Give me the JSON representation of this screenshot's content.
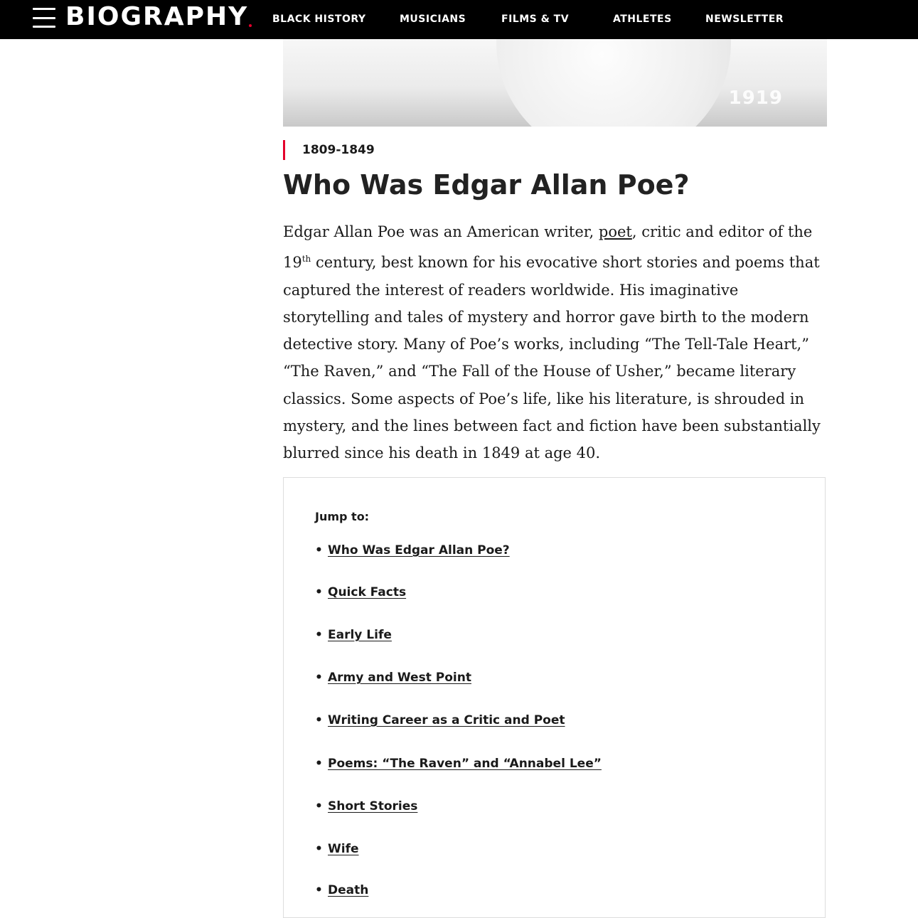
{
  "nav": {
    "logo_text": "BIOGRAPHY",
    "items": [
      {
        "label": "BLACK HISTORY"
      },
      {
        "label": "MUSICIANS"
      },
      {
        "label": "FILMS & TV"
      },
      {
        "label": "ATHLETES"
      },
      {
        "label": "NEWSLETTER"
      }
    ]
  },
  "hero": {
    "credit": "1919"
  },
  "article": {
    "dates": "1809-1849",
    "headline": "Who Was Edgar Allan Poe?",
    "lede_parts": {
      "p1": "Edgar Allan Poe was an American writer, ",
      "link_poet": "poet",
      "p2": ", critic and editor of the 19",
      "sup": "th",
      "p3": " century, best known for his evocative short stories and poems that captured the interest of readers worldwide. His imaginative storytelling and tales of mystery and horror gave birth to the modern detective story. Many of Poe’s works, including “The Tell-Tale Heart,” “The Raven,” and “The Fall of the House of Usher,” became literary classics. Some aspects of Poe’s life, like his literature, is shrouded in mystery, and the lines between fact and fiction have been substantially blurred since his death in 1849 at age 40."
    }
  },
  "jump_to": {
    "title": "Jump to:",
    "items": [
      {
        "label": "Who Was Edgar Allan Poe?"
      },
      {
        "label": "Quick Facts"
      },
      {
        "label": "Early Life"
      },
      {
        "label": "Army and West Point"
      },
      {
        "label": "Writing Career as a Critic and Poet"
      },
      {
        "label": "Poems: “The Raven” and “Annabel Lee”"
      },
      {
        "label": "Short Stories"
      },
      {
        "label": "Wife"
      },
      {
        "label": "Death"
      }
    ]
  }
}
